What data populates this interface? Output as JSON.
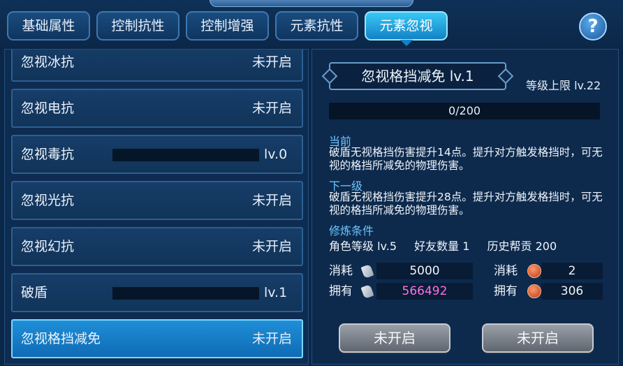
{
  "tabs": [
    "基础属性",
    "控制抗性",
    "控制增强",
    "元素抗性",
    "元素忽视"
  ],
  "help_label": "?",
  "list": [
    {
      "name": "忽视冰抗",
      "status": "未开启"
    },
    {
      "name": "忽视电抗",
      "status": "未开启"
    },
    {
      "name": "忽视毒抗",
      "level": "lv.0"
    },
    {
      "name": "忽视光抗",
      "status": "未开启"
    },
    {
      "name": "忽视幻抗",
      "status": "未开启"
    },
    {
      "name": "破盾",
      "level": "lv.1"
    },
    {
      "name": "忽视格挡减免",
      "status": "未开启"
    }
  ],
  "detail": {
    "title": "忽视格挡减免  lv.1",
    "level_cap": "等级上限 lv.22",
    "progress_text": "0/200",
    "current_heading": "当前",
    "current_desc": "破盾无视格挡伤害提升14点。提升对方触发格挡时，可无视的格挡所减免的物理伤害。",
    "next_heading": "下一级",
    "next_desc": "破盾无视格挡伤害提升28点。提升对方触发格挡时，可无视的格挡所减免的物理伤害。",
    "cond_heading": "修炼条件",
    "conditions": [
      "角色等级 lv.5",
      "好友数量 1",
      "历史帮贡 200"
    ],
    "cost_label": "消耗",
    "own_label": "拥有",
    "scroll_cost": "5000",
    "scroll_own": "566492",
    "coin_cost": "2",
    "coin_own": "306",
    "button1": "未开启",
    "button2": "未开启"
  }
}
